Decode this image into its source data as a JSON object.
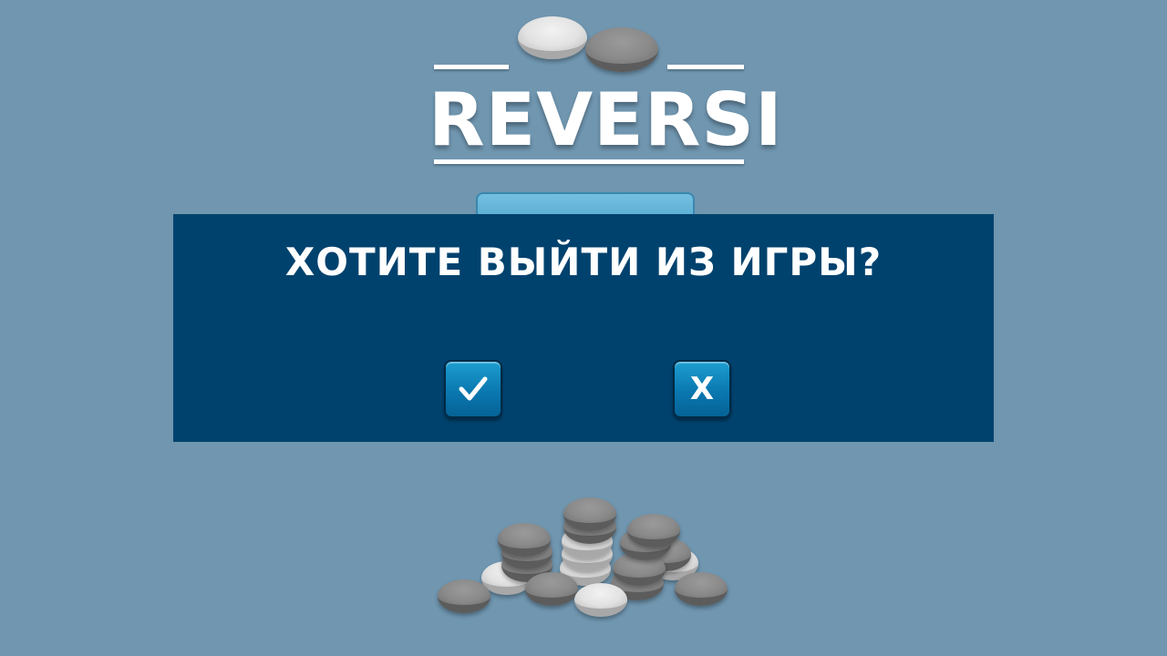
{
  "logo": {
    "title": "REVERSI"
  },
  "dialog": {
    "title": "ХОТИТЕ ВЫЙТИ ИЗ ИГРЫ?",
    "confirm_icon": "checkmark-icon",
    "cancel_label": "X"
  },
  "colors": {
    "background": "#7096b0",
    "dialog": "#00426e",
    "button": "#0a78b0"
  }
}
